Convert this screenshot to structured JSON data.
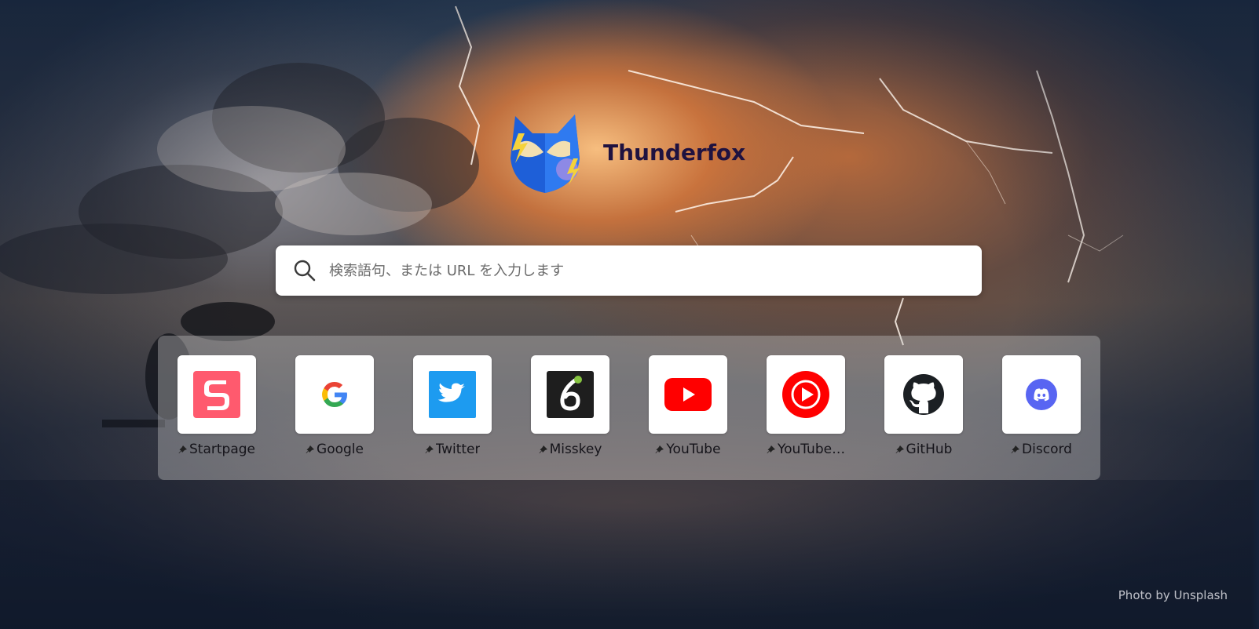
{
  "app": {
    "name": "Thunderfox"
  },
  "search": {
    "placeholder": "検索語句、または URL を入力します",
    "icon": "search-icon"
  },
  "top_sites": [
    {
      "label": "Startpage",
      "icon": "startpage-icon",
      "pinned": true,
      "color": "#ff5a6e"
    },
    {
      "label": "Google",
      "icon": "google-icon",
      "pinned": true,
      "color": "#4285f4"
    },
    {
      "label": "Twitter",
      "icon": "twitter-icon",
      "pinned": true,
      "color": "#1d9bf0"
    },
    {
      "label": "Misskey",
      "icon": "misskey-icon",
      "pinned": true,
      "color": "#1e1e1e"
    },
    {
      "label": "YouTube",
      "icon": "youtube-icon",
      "pinned": true,
      "color": "#ff0000"
    },
    {
      "label": "YouTube…",
      "icon": "youtube-music-icon",
      "pinned": true,
      "color": "#ff0000"
    },
    {
      "label": "GitHub",
      "icon": "github-icon",
      "pinned": true,
      "color": "#1b1f23"
    },
    {
      "label": "Discord",
      "icon": "discord-icon",
      "pinned": true,
      "color": "#5865f2"
    }
  ],
  "credit": {
    "text": "Photo by Unsplash"
  }
}
